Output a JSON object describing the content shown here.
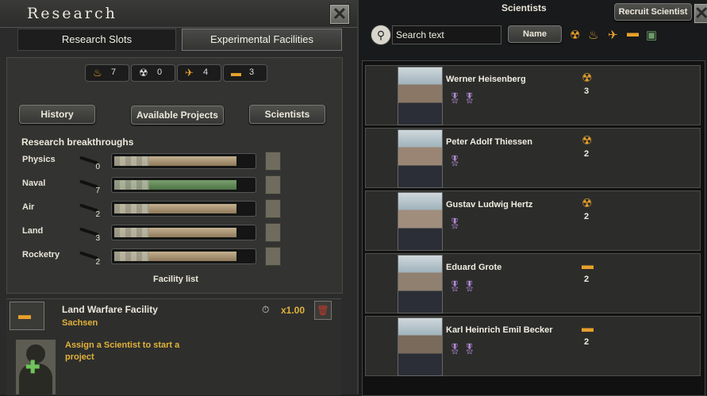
{
  "left_panel": {
    "title": "Research",
    "close_glyph": "✕",
    "tabs": [
      "Research Slots",
      "Experimental Facilities"
    ],
    "counters": [
      {
        "icon": "industry-icon",
        "glyph": "♨",
        "value": "7"
      },
      {
        "icon": "nuclear-icon",
        "glyph": "☢",
        "value": "0"
      },
      {
        "icon": "air-icon",
        "glyph": "✈",
        "value": "4"
      },
      {
        "icon": "tank-icon",
        "glyph": "▬",
        "value": "3"
      }
    ],
    "buttons": {
      "history": "History",
      "available_projects": "Available Projects",
      "scientists": "Scientists"
    },
    "breakthroughs_title": "Research breakthroughs",
    "breakthroughs": [
      {
        "label": "Physics",
        "value": "0",
        "fill": 0.88,
        "color": "tan"
      },
      {
        "label": "Naval",
        "value": "7",
        "fill": 0.88,
        "color": "green"
      },
      {
        "label": "Air",
        "value": "2",
        "fill": 0.88,
        "color": "tan"
      },
      {
        "label": "Land",
        "value": "3",
        "fill": 0.88,
        "color": "tan"
      },
      {
        "label": "Rocketry",
        "value": "2",
        "fill": 0.88,
        "color": "tan"
      }
    ],
    "facility_list_title": "Facility list",
    "facility": {
      "name": "Land Warfare Facility",
      "location": "Sachsen",
      "multiplier": "x1.00",
      "assign_text": "Assign a Scientist to start a project"
    }
  },
  "right_panel": {
    "title": "Scientists",
    "recruit_label": "Recruit Scientist",
    "search_placeholder": "Search text",
    "sort_label": "Name",
    "filter_icons": [
      "nuclear-icon",
      "industry-icon",
      "air-icon",
      "tank-icon",
      "radar-icon"
    ],
    "scientists": [
      {
        "name": "Werner Heisenberg",
        "icon": "nuclear-icon",
        "glyph": "☢",
        "level": "3",
        "medals": "🎖🎖",
        "skin": "#8a7766"
      },
      {
        "name": "Peter Adolf Thiessen",
        "icon": "nuclear-icon",
        "glyph": "☢",
        "level": "2",
        "medals": "🎖",
        "skin": "#9a8574"
      },
      {
        "name": "Gustav Ludwig Hertz",
        "icon": "nuclear-icon",
        "glyph": "☢",
        "level": "2",
        "medals": "🎖",
        "skin": "#a08d7c"
      },
      {
        "name": "Eduard Grote",
        "icon": "tank-icon",
        "glyph": "▬",
        "level": "2",
        "medals": "🎖🎖",
        "skin": "#908070"
      },
      {
        "name": "Karl Heinrich Emil Becker",
        "icon": "tank-icon",
        "glyph": "▬",
        "level": "2",
        "medals": "🎖🎖",
        "skin": "#7a6a5c"
      }
    ]
  }
}
